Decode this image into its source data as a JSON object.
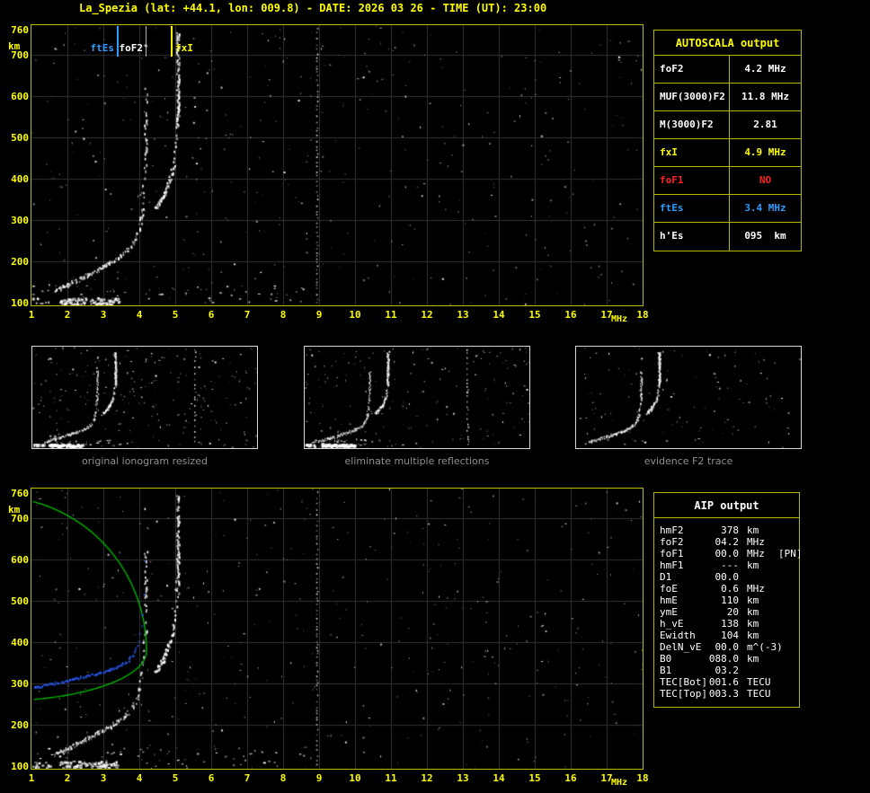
{
  "title": "La_Spezia (lat: +44.1, lon: 009.8) - DATE: 2026 03 26 - TIME (UT): 23:00",
  "colors": {
    "accent_yellow": "#ffff00",
    "table_border": "#b8b800",
    "blue": "#2f9bff",
    "red": "#ff2222",
    "green": "#00b400",
    "grid": "#333333",
    "caption_gray": "#8f8f8f"
  },
  "main_plot": {
    "y_unit": "km",
    "x_unit": "MHz",
    "y_ticks": [
      760,
      700,
      600,
      500,
      400,
      300,
      200,
      100
    ],
    "x_ticks": [
      1,
      2,
      3,
      4,
      5,
      6,
      7,
      8,
      9,
      10,
      11,
      12,
      13,
      14,
      15,
      16,
      17,
      18
    ],
    "markers": [
      {
        "label": "ftEs",
        "freq": 3.4,
        "color": "#2f9bff",
        "label_side": "left"
      },
      {
        "label": "foF2",
        "freq": 4.2,
        "color": "#ffffff",
        "label_side": "left"
      },
      {
        "label": "fxI",
        "freq": 4.9,
        "color": "#ffff00",
        "label_side": "right"
      }
    ]
  },
  "autoscala": {
    "header": "AUTOSCALA output",
    "rows": [
      {
        "label": "foF2",
        "value": "4.2 MHz",
        "color": "#ffffff"
      },
      {
        "label": "MUF(3000)F2",
        "value": "11.8 MHz",
        "color": "#ffffff"
      },
      {
        "label": "M(3000)F2",
        "value": "2.81",
        "color": "#ffffff"
      },
      {
        "label": "fxI",
        "value": "4.9 MHz",
        "color": "#ffff00"
      },
      {
        "label": "foF1",
        "value": "NO",
        "color": "#ff2222"
      },
      {
        "label": "ftEs",
        "value": "3.4 MHz",
        "color": "#2f9bff"
      },
      {
        "label": "h'Es",
        "value": "095  km",
        "color": "#ffffff"
      }
    ]
  },
  "thumbnails": [
    {
      "caption": "original ionogram resized"
    },
    {
      "caption": "eliminate multiple reflections"
    },
    {
      "caption": "evidence F2 trace"
    }
  ],
  "aip": {
    "header": "AIP output",
    "rows": [
      {
        "label": "hmF2",
        "value": "378",
        "unit": "km",
        "note": ""
      },
      {
        "label": "foF2",
        "value": "04.2",
        "unit": "MHz",
        "note": ""
      },
      {
        "label": "foF1",
        "value": "00.0",
        "unit": "MHz",
        "note": "[PN]"
      },
      {
        "label": "hmF1",
        "value": "---",
        "unit": "km",
        "note": ""
      },
      {
        "label": "D1",
        "value": "00.0",
        "unit": "",
        "note": ""
      },
      {
        "label": "foE",
        "value": "0.6",
        "unit": "MHz",
        "note": ""
      },
      {
        "label": "hmE",
        "value": "110",
        "unit": "km",
        "note": ""
      },
      {
        "label": "ymE",
        "value": "20",
        "unit": "km",
        "note": ""
      },
      {
        "label": "h_vE",
        "value": "138",
        "unit": "km",
        "note": ""
      },
      {
        "label": "Ewidth",
        "value": "104",
        "unit": "km",
        "note": ""
      },
      {
        "label": "DelN_vE",
        "value": "00.0",
        "unit": "m^(-3)",
        "note": ""
      },
      {
        "label": "B0",
        "value": "088.0",
        "unit": "km",
        "note": ""
      },
      {
        "label": "B1",
        "value": "03.2",
        "unit": "",
        "note": ""
      },
      {
        "label": "TEC[Bot]",
        "value": "001.6",
        "unit": "TECU",
        "note": ""
      },
      {
        "label": "TEC[Top]",
        "value": "003.3",
        "unit": "TECU",
        "note": ""
      }
    ]
  },
  "chart_data": {
    "type": "scatter",
    "description": "Vertical incidence ionogram: virtual height (km) vs sounding frequency (MHz), with autoscaled traces and electron-density profile",
    "x_range": [
      1,
      18
    ],
    "y_range": [
      100,
      760
    ],
    "xlabel": "MHz",
    "ylabel": "km",
    "scaled_parameters": {
      "foF2_MHz": 4.2,
      "fxI_MHz": 4.9,
      "ftEs_MHz": 3.4,
      "hEs_km": 95,
      "MUF3000F2_MHz": 11.8,
      "M3000F2": 2.81,
      "foF1": "NO"
    },
    "o_mode_trace_points": [
      [
        1.7,
        130
      ],
      [
        2.2,
        152
      ],
      [
        2.8,
        176
      ],
      [
        3.2,
        195
      ],
      [
        3.6,
        225
      ],
      [
        3.9,
        275
      ],
      [
        4.0,
        290
      ],
      [
        4.1,
        365
      ],
      [
        4.15,
        495
      ],
      [
        4.17,
        615
      ]
    ],
    "x_mode_trace_points": [
      [
        4.5,
        330
      ],
      [
        4.8,
        395
      ],
      [
        5.0,
        495
      ],
      [
        5.07,
        600
      ],
      [
        5.1,
        760
      ]
    ],
    "es_layer": {
      "height_km": 95,
      "freq_span_MHz": [
        1.0,
        3.4
      ]
    },
    "profile": {
      "hmF2_km": 378,
      "foF2_MHz": 4.2,
      "foE_MHz": 0.6,
      "hmE_km": 110,
      "B0_km": 88.0,
      "B1": 3.2,
      "TEC_bot_TECU": 1.6,
      "TEC_top_TECU": 3.3
    }
  }
}
